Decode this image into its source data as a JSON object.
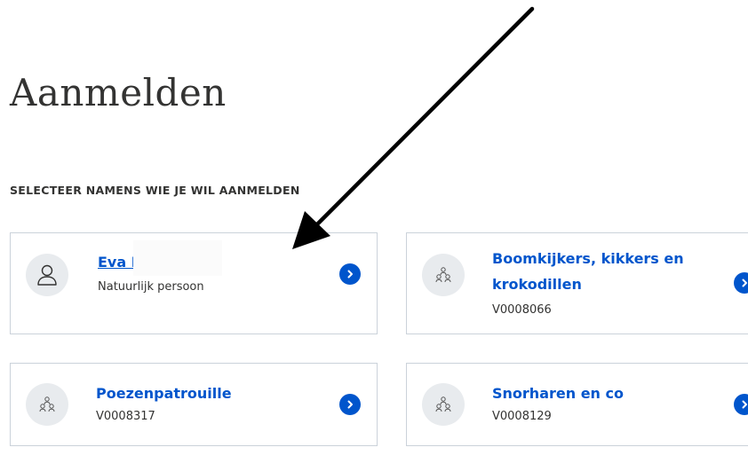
{
  "page": {
    "title": "Aanmelden",
    "section_label": "SELECTEER NAMENS WIE JE WIL AANMELDEN"
  },
  "cards": [
    {
      "name": "Eva I",
      "subtitle": "Natuurlijk persoon",
      "avatar_icon": "person-icon"
    },
    {
      "name_line1": "Boomkijkers, kikkers en",
      "name_line2": "krokodillen",
      "subtitle": "V0008066",
      "avatar_icon": "group-icon"
    },
    {
      "name": "Poezenpatrouille",
      "subtitle": "V0008317",
      "avatar_icon": "group-icon"
    },
    {
      "name": "Snorharen en co",
      "subtitle": "V0008129",
      "avatar_icon": "group-icon"
    }
  ],
  "colors": {
    "link_blue": "#0055cc",
    "border": "#cbd2da",
    "avatar_bg": "#e8ebee",
    "text": "#333332"
  }
}
